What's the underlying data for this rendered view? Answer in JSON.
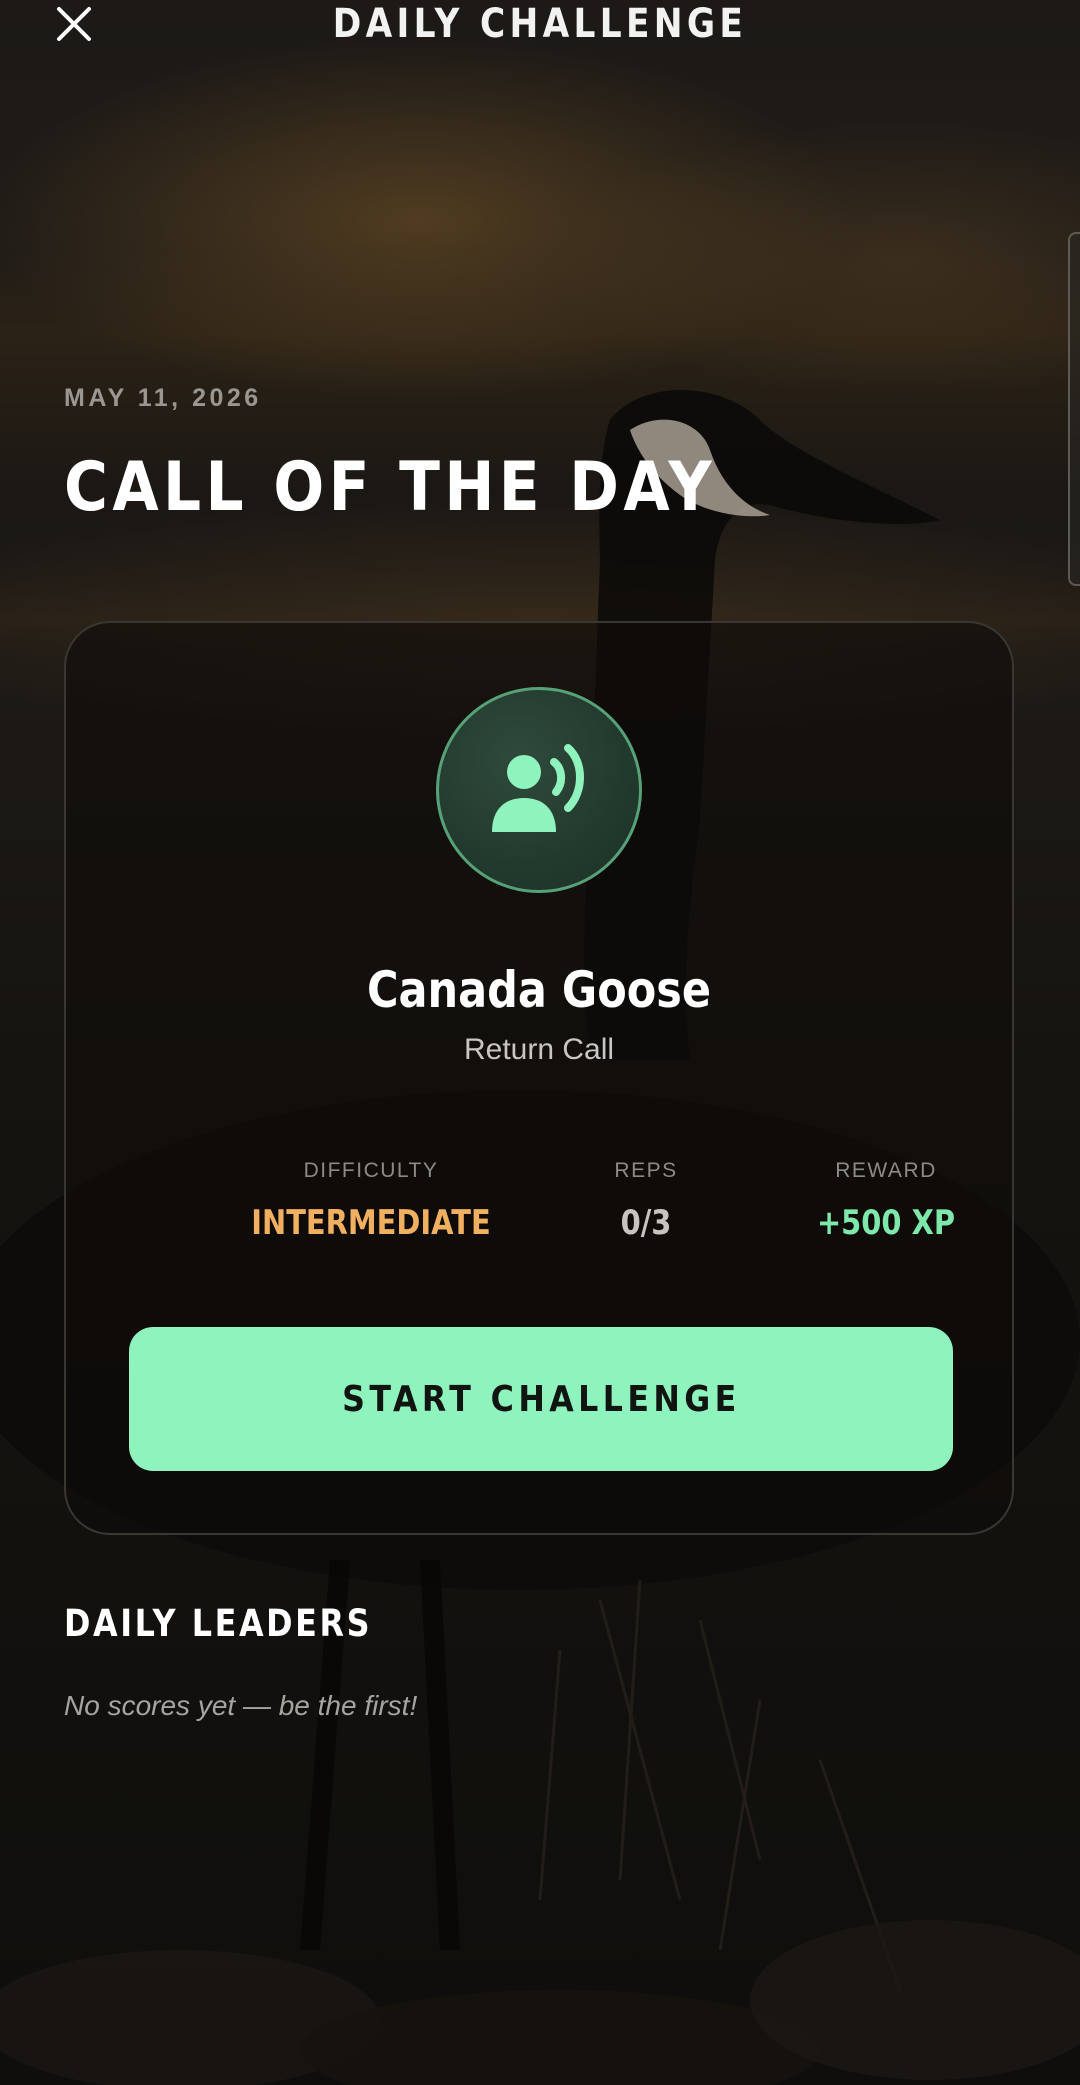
{
  "header": {
    "title": "DAILY CHALLENGE",
    "close_icon": "close-icon"
  },
  "hero": {
    "date": "MAY 11, 2026",
    "title": "CALL OF THE DAY"
  },
  "challenge": {
    "icon": "caller-sound-icon",
    "species": "Canada Goose",
    "call_type": "Return Call",
    "stats": {
      "difficulty_label": "DIFFICULTY",
      "difficulty_value": "INTERMEDIATE",
      "reps_label": "REPS",
      "reps_value": "0/3",
      "reward_label": "REWARD",
      "reward_value": "+500 XP"
    },
    "start_button": "START CHALLENGE"
  },
  "leaders": {
    "title": "DAILY LEADERS",
    "empty_message": "No scores yet — be the first!"
  },
  "colors": {
    "accent": "#8ef3bd",
    "accent_text": "#7ee8ab",
    "difficulty": "#f0b060",
    "background": "#0d0b09"
  }
}
